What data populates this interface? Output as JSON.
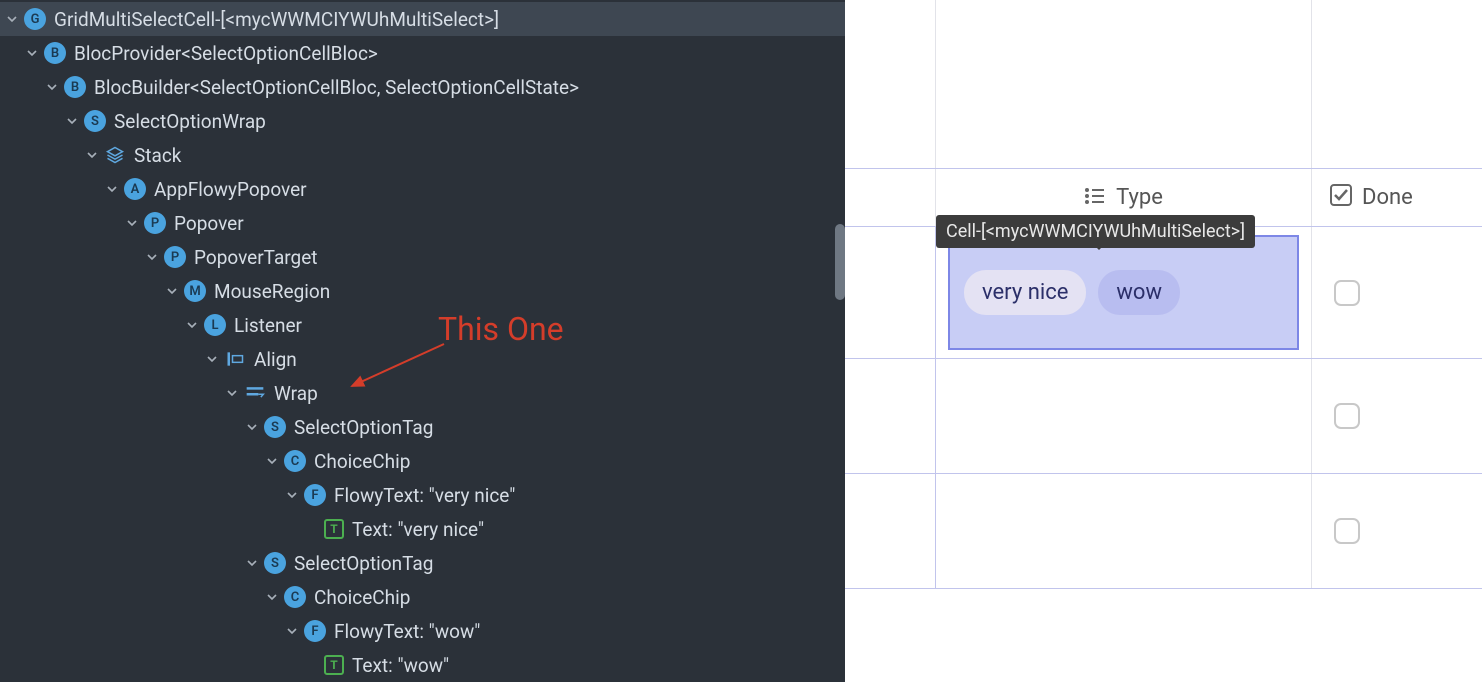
{
  "tree": {
    "rows": [
      {
        "indent": 0,
        "chev": true,
        "badgeType": "blue",
        "badgeChar": "G",
        "label": "GridMultiSelectCell-[<mycWWMCIYWUhMultiSelect>]",
        "selected": true
      },
      {
        "indent": 1,
        "chev": true,
        "badgeType": "blue",
        "badgeChar": "B",
        "label": "BlocProvider<SelectOptionCellBloc>"
      },
      {
        "indent": 2,
        "chev": true,
        "badgeType": "blue",
        "badgeChar": "B",
        "label": "BlocBuilder<SelectOptionCellBloc, SelectOptionCellState>"
      },
      {
        "indent": 3,
        "chev": true,
        "badgeType": "blue",
        "badgeChar": "S",
        "label": "SelectOptionWrap"
      },
      {
        "indent": 4,
        "chev": true,
        "iconType": "stack",
        "label": "Stack"
      },
      {
        "indent": 5,
        "chev": true,
        "badgeType": "blue",
        "badgeChar": "A",
        "label": "AppFlowyPopover",
        "guide": true
      },
      {
        "indent": 6,
        "chev": true,
        "badgeType": "blue",
        "badgeChar": "P",
        "label": "Popover"
      },
      {
        "indent": 7,
        "chev": true,
        "badgeType": "blue",
        "badgeChar": "P",
        "label": "PopoverTarget"
      },
      {
        "indent": 8,
        "chev": true,
        "badgeType": "blue",
        "badgeChar": "M",
        "label": "MouseRegion"
      },
      {
        "indent": 9,
        "chev": true,
        "badgeType": "blue",
        "badgeChar": "L",
        "label": "Listener"
      },
      {
        "indent": 10,
        "chev": true,
        "iconType": "align",
        "label": "Align"
      },
      {
        "indent": 11,
        "chev": true,
        "iconType": "wrap",
        "label": "Wrap"
      },
      {
        "indent": 12,
        "chev": true,
        "badgeType": "blue",
        "badgeChar": "S",
        "label": "SelectOptionTag",
        "guide": true
      },
      {
        "indent": 13,
        "chev": true,
        "badgeType": "blue",
        "badgeChar": "C",
        "label": "ChoiceChip"
      },
      {
        "indent": 14,
        "chev": true,
        "badgeType": "blue",
        "badgeChar": "F",
        "label": "FlowyText: \"very nice\""
      },
      {
        "indent": 15,
        "chev": false,
        "badgeType": "green",
        "badgeChar": "T",
        "label": "Text: \"very nice\""
      },
      {
        "indent": 12,
        "chev": true,
        "badgeType": "blue",
        "badgeChar": "S",
        "label": "SelectOptionTag",
        "guide": true
      },
      {
        "indent": 13,
        "chev": true,
        "badgeType": "blue",
        "badgeChar": "C",
        "label": "ChoiceChip"
      },
      {
        "indent": 14,
        "chev": true,
        "badgeType": "blue",
        "badgeChar": "F",
        "label": "FlowyText: \"wow\""
      },
      {
        "indent": 15,
        "chev": false,
        "badgeType": "green",
        "badgeChar": "T",
        "label": "Text: \"wow\""
      }
    ]
  },
  "annotation": {
    "text": "This One"
  },
  "preview": {
    "tooltip": "Cell-[<mycWWMCIYWUhMultiSelect>]",
    "headers": {
      "col2": "Type",
      "col3": "Done"
    },
    "chips": {
      "a": "very nice",
      "b": "wow"
    }
  }
}
